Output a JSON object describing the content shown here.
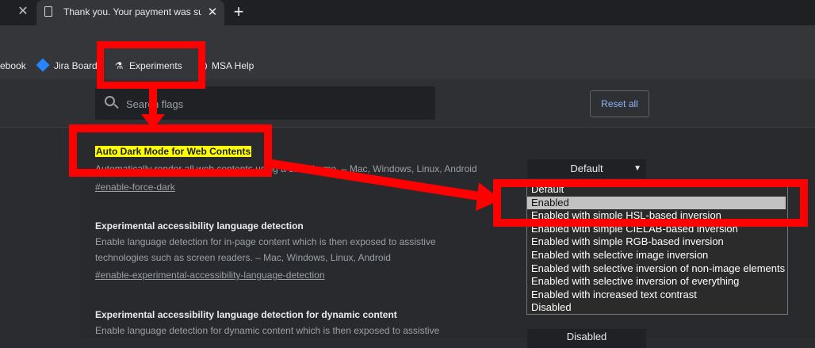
{
  "tabs": {
    "active_title": "Thank you. Your payment was successful",
    "close_glyph": "✕",
    "new_tab_glyph": "+"
  },
  "bookmarks": {
    "items": [
      {
        "label": "ebook",
        "icon": "facebook-icon"
      },
      {
        "label": "Jira Board",
        "icon": "jira-icon"
      },
      {
        "label": "Experiments",
        "icon": "flask-icon"
      },
      {
        "label": "MSA Help",
        "icon": "help-icon"
      }
    ]
  },
  "search": {
    "placeholder": "Search flags",
    "value": ""
  },
  "header": {
    "reset_label": "Reset all"
  },
  "flags": [
    {
      "title": "Auto Dark Mode for Web Contents",
      "description": "Automatically render all web contents using a dark theme. – Mac, Windows, Linux, Android",
      "link": "#enable-force-dark",
      "selected": "Default"
    },
    {
      "title": "Experimental accessibility language detection",
      "description_line1": "Enable language detection for in-page content which is then exposed to assistive",
      "description_line2": "technologies such as screen readers. – Mac, Windows, Linux, Android",
      "link": "#enable-experimental-accessibility-language-detection"
    },
    {
      "title": "Experimental accessibility language detection for dynamic content",
      "description_line1": "Enable language detection for dynamic content which is then exposed to assistive",
      "selected": "Disabled"
    }
  ],
  "dropdown": {
    "options": [
      "Default",
      "Enabled",
      "Enabled with simple HSL-based inversion",
      "Enabled with simple CIELAB-based inversion",
      "Enabled with simple RGB-based inversion",
      "Enabled with selective image inversion",
      "Enabled with selective inversion of non-image elements",
      "Enabled with selective inversion of everything",
      "Enabled with increased text contrast",
      "Disabled"
    ],
    "highlighted": "Enabled"
  },
  "colors": {
    "annotation": "#ff0000",
    "highlight": "#ffff00",
    "link": "#8ab4f8"
  }
}
